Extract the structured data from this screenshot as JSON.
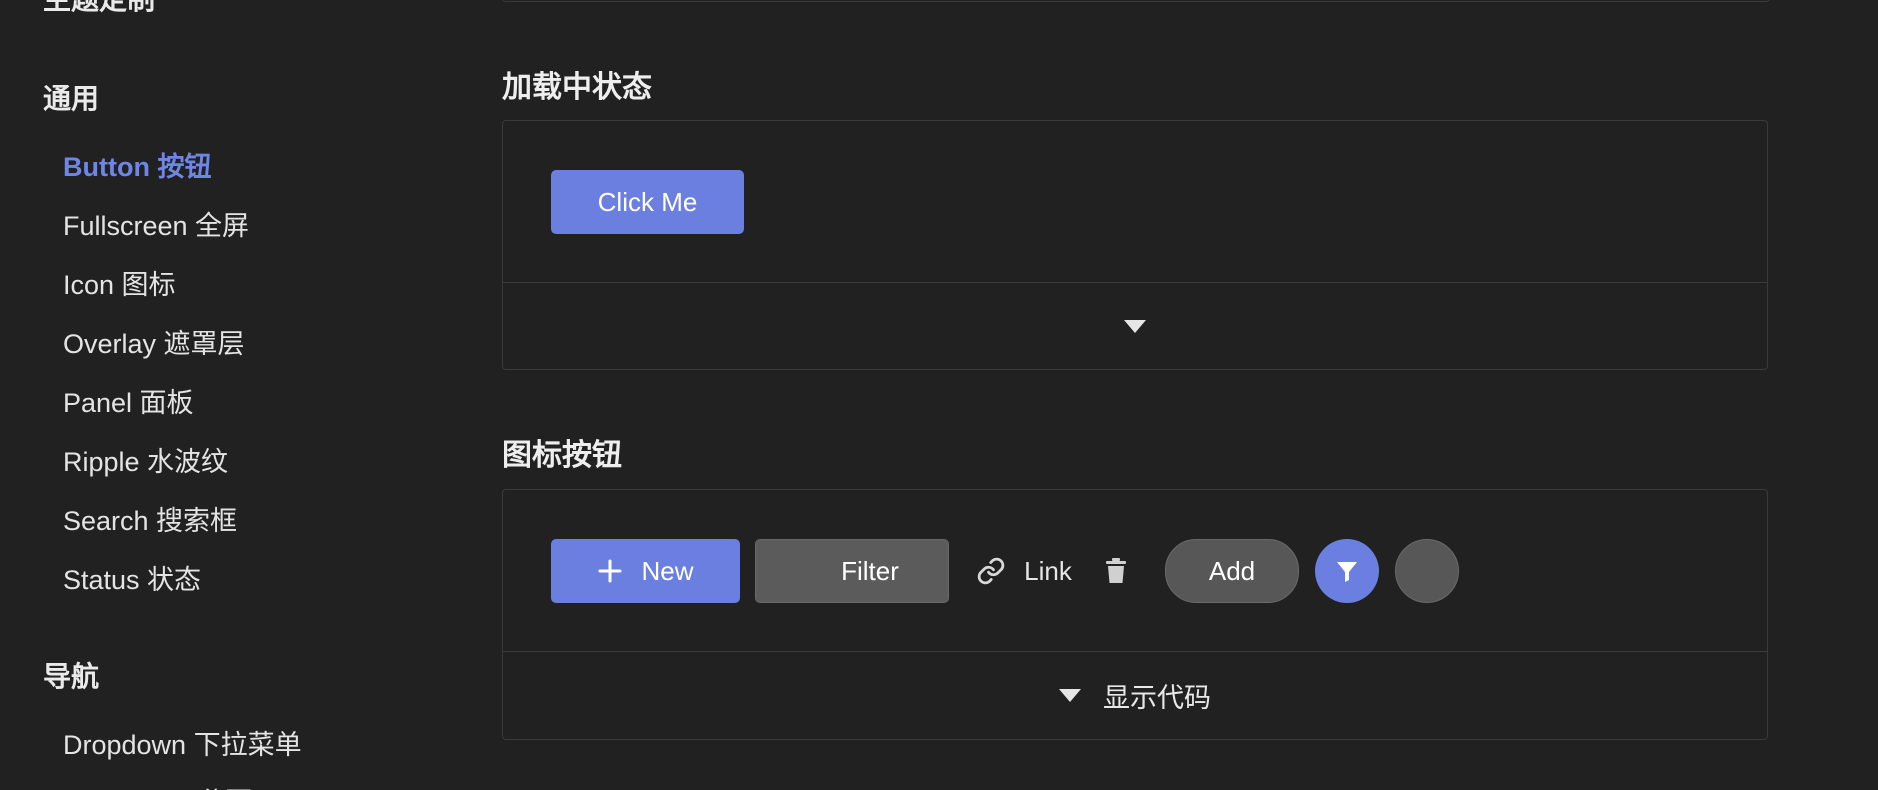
{
  "sidebar": {
    "cut_group_title": "主题定制",
    "groups": [
      {
        "title": "通用",
        "items": [
          {
            "label": "Button 按钮",
            "active": true
          },
          {
            "label": "Fullscreen 全屏"
          },
          {
            "label": "Icon 图标"
          },
          {
            "label": "Overlay 遮罩层"
          },
          {
            "label": "Panel 面板"
          },
          {
            "label": "Ripple 水波纹"
          },
          {
            "label": "Search 搜索框"
          },
          {
            "label": "Status 状态"
          }
        ]
      },
      {
        "title": "导航",
        "items": [
          {
            "label": "Dropdown 下拉菜单"
          },
          {
            "label": "Pagination 分页"
          }
        ]
      }
    ]
  },
  "sections": {
    "loading": {
      "title": "加载中状态",
      "button_label": "Click Me"
    },
    "icon_buttons": {
      "title": "图标按钮",
      "new_label": "New",
      "filter_label": "Filter",
      "link_label": "Link",
      "add_label": "Add",
      "show_code_label": "显示代码"
    }
  },
  "colors": {
    "background": "#212121",
    "primary": "#6a7fdf",
    "active_nav": "#6f86e6",
    "border": "#3a3a3a",
    "gray_button": "#5b5b5b"
  },
  "icons": [
    "plus-icon",
    "link-icon",
    "trash-icon",
    "filter-icon",
    "caret-down-icon"
  ]
}
